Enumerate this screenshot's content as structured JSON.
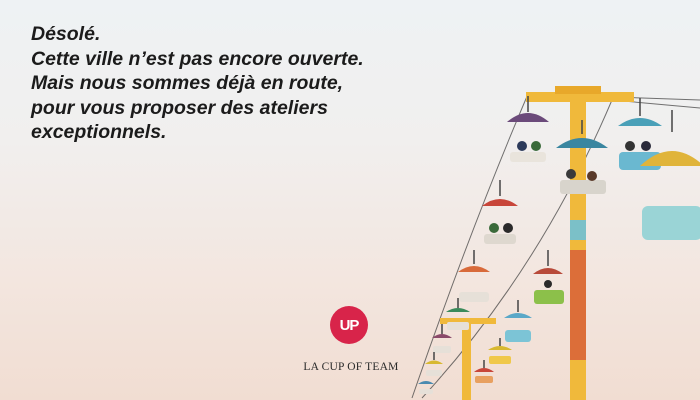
{
  "message": {
    "line1": "Désolé.",
    "line2": "Cette ville n’est pas encore ouverte.",
    "line3": "Mais nous sommes déjà en route,",
    "line4": "pour vous proposer des ateliers",
    "line5": "exceptionnels."
  },
  "brand": {
    "logo_text": "UP",
    "name": "LA CUP OF TEAM",
    "accent": "#d8244a"
  },
  "photo": {
    "subject": "chairlift-ride-photo",
    "tower_color": "#f0b93b",
    "cabin_colors": [
      "#6b4a7a",
      "#3a86a0",
      "#e0b43a",
      "#c8463a",
      "#8cc04a",
      "#d86a3a",
      "#5aa8c8",
      "#d8b830"
    ]
  }
}
